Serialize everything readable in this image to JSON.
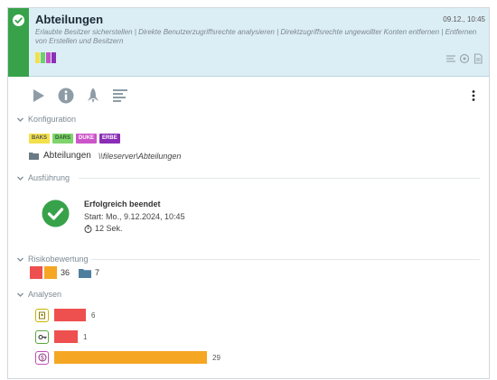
{
  "header": {
    "title": "Abteilungen",
    "date": "09.12., 10:45",
    "description": "Erlaubte Besitzer sicherstellen | Direkte Benutzerzugriffsrechte analysieren | Direktzugriffsrechte ungewollter Konten entfernen | Entfernen von Erstellen und Besitzern",
    "swatch_colors": [
      "#f1e04b",
      "#6fd06b",
      "#c44fc5",
      "#8b2fb8"
    ],
    "status_color": "#37a24a"
  },
  "toolbar": {
    "icons": [
      "play-icon",
      "info-icon",
      "rocket-icon",
      "report-icon"
    ],
    "menu_icon": "kebab-menu-icon"
  },
  "sections": {
    "config": "Konfiguration",
    "execution": "Ausführung",
    "risk": "Risikobewertung",
    "analyses": "Analysen"
  },
  "config": {
    "tags": [
      {
        "label": "BAKS",
        "bg": "#f4e04a",
        "fg": "#555"
      },
      {
        "label": "DARS",
        "bg": "#7fd46c",
        "fg": "#2e5a2a"
      },
      {
        "label": "DUKE",
        "bg": "#cc56c9",
        "fg": "#ffffff"
      },
      {
        "label": "ERBE",
        "bg": "#8a2db6",
        "fg": "#ffffff"
      }
    ],
    "folder_name": "Abteilungen",
    "folder_path": "\\\\fileserver\\Abteilungen"
  },
  "execution": {
    "status": "Erfolgreich beendet",
    "start": "Start: Mo., 9.12.2024, 10:45",
    "duration": "12 Sek."
  },
  "risk": {
    "high_color": "#ee4f4f",
    "medium_color": "#f5a623",
    "medium_count": "36",
    "folder_count": "7"
  },
  "analyses": [
    {
      "icon": "owner-badge-icon",
      "badge_color": "#c9b400",
      "bar_color": "#ee4f4f",
      "value": 6
    },
    {
      "icon": "key-badge-icon",
      "badge_color": "#5aa83c",
      "bar_color": "#ee4f4f",
      "value": 1
    },
    {
      "icon": "dollar-badge-icon",
      "badge_color": "#c04fb9",
      "bar_color": "#f5a623",
      "value": 29
    }
  ]
}
